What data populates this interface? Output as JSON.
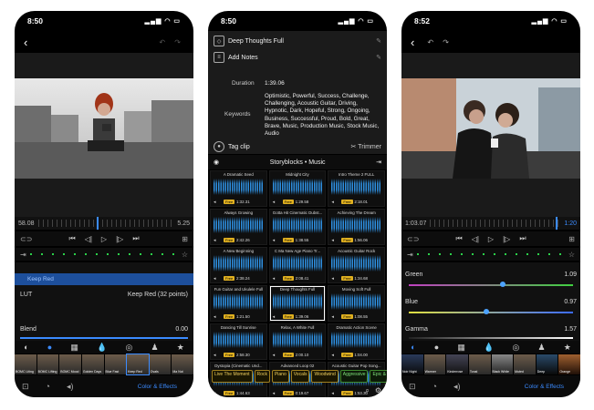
{
  "phone1": {
    "time": "8:50",
    "timeline_start": "58.08",
    "timeline_end": "5.25",
    "highlighted_item": "Keep Red",
    "lut_label": "LUT",
    "lut_value": "Keep Red (32 points)",
    "blend_label": "Blend",
    "blend_value": "0.00",
    "thumbs": [
      "BOMC Liting",
      "BOMC Lifting",
      "BOMC Mood",
      "Golden Days",
      "Blue Fast",
      "Keep Red",
      "Ovals",
      "Ma Nut"
    ],
    "tab_label": "Color & Effects"
  },
  "phone2": {
    "time": "8:50",
    "clip_title": "Deep Thoughts Full",
    "add_notes": "Add Notes",
    "duration_label": "Duration",
    "duration_value": "1:39.06",
    "keywords_label": "Keywords",
    "keywords_value": "Optimistic, Powerful, Success, Challenge, Challenging, Acoustic Guitar, Driving, Hypnotic, Dark, Hopeful, Strong, Ongoing, Business, Successful, Proud, Bold, Great, Brave, Music, Production Music, Stock Music, Audio",
    "tag_clip": "Tag clip",
    "trimmer": "Trimmer",
    "library_title": "Storyblocks • Music",
    "cells": [
      {
        "title": "A Dramatic Seed",
        "dur": "1:32.31"
      },
      {
        "title": "Midnight City",
        "dur": "1:29.58"
      },
      {
        "title": "Intro Theme 2 FULL",
        "dur": "2:18.01"
      },
      {
        "title": "Always Growing",
        "dur": "2:42.26"
      },
      {
        "title": "Gotta Hit Cinematic Dubst...",
        "dur": "1:38.55"
      },
      {
        "title": "Achieving The Dream",
        "dur": "1:56.06"
      },
      {
        "title": "A New Beginning",
        "dur": "2:38.24"
      },
      {
        "title": "C Ma New Age Piano Tr...",
        "dur": "2:08.41"
      },
      {
        "title": "Acoustic Guitar Rock",
        "dur": "1:34.68"
      },
      {
        "title": "Fun Guitar and Ukulele Full",
        "dur": "1:21.50"
      },
      {
        "title": "Deep Thoughts Full",
        "dur": "1:39.06"
      },
      {
        "title": "Moving Soft Full",
        "dur": "1:08.55"
      },
      {
        "title": "Dancing Till Sunrise",
        "dur": "2:58.30"
      },
      {
        "title": "Relax, A White Full",
        "dur": "2:00.10"
      },
      {
        "title": "Dramatic Action Scene",
        "dur": "1:04.00"
      },
      {
        "title": "Dystopia (Cinematic Und...",
        "dur": "1:44.63"
      },
      {
        "title": "Advanced Loop 02",
        "dur": "0:19.67"
      },
      {
        "title": "Acoustic Guitar Pop Song...",
        "dur": "1:53.30"
      }
    ],
    "tags": [
      {
        "label": "Live The Moment",
        "color": "yellow"
      },
      {
        "label": "Rock",
        "color": "yellow"
      },
      {
        "label": "Piano",
        "color": "yellow"
      },
      {
        "label": "Vocals",
        "color": "yellow"
      },
      {
        "label": "Woodwind",
        "color": "yellow"
      },
      {
        "label": "Aggressive",
        "color": "green"
      },
      {
        "label": "Epic & Inspiring",
        "color": "green"
      },
      {
        "label": "Hap",
        "color": "green"
      }
    ],
    "free_badge": "Free"
  },
  "phone3": {
    "time": "8:52",
    "timeline_start": "1:03.07",
    "timeline_end": "1:20",
    "green_label": "Green",
    "green_value": "1.09",
    "blue_label": "Blue",
    "blue_value": "0.97",
    "gamma_label": "Gamma",
    "gamma_value": "1.57",
    "thumbs": [
      "Noir Night",
      "Warmer",
      "Kinderrose",
      "Tonal",
      "Black White",
      "Muted",
      "Deep",
      "Orange"
    ],
    "tab_label": "Color & Effects"
  },
  "colors": {
    "accent": "#3b8bff",
    "waveform": "#2e8fe0",
    "free_badge": "#e0b020"
  }
}
